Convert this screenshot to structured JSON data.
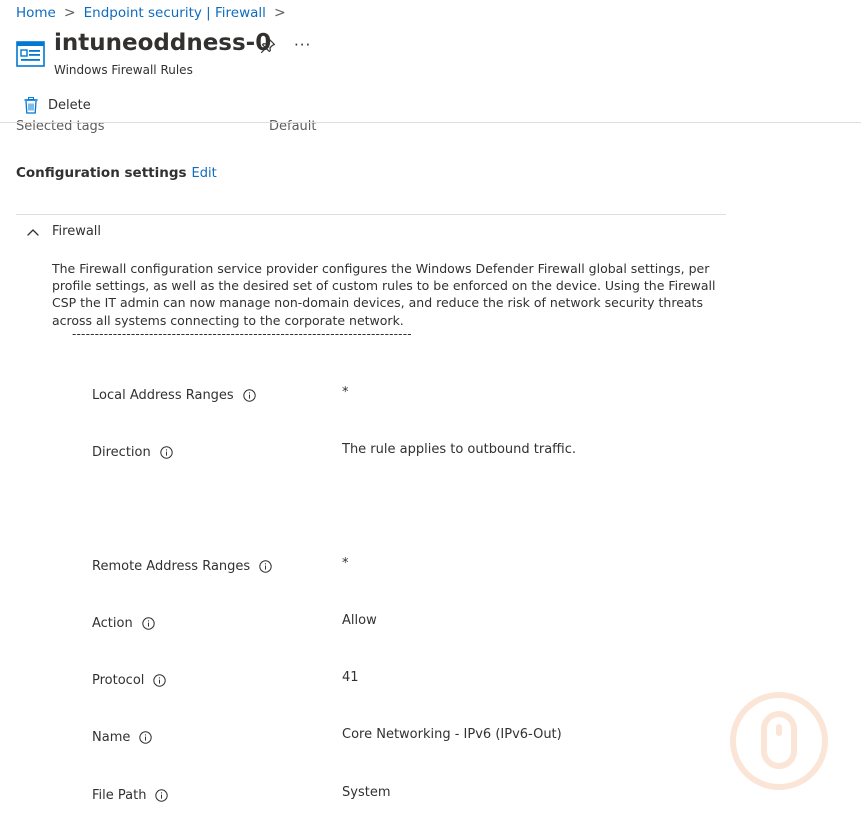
{
  "breadcrumb": {
    "home": "Home",
    "separator": ">",
    "parent": "Endpoint security | Firewall"
  },
  "header": {
    "title": "intuneoddness-0",
    "subtitle": "Windows Firewall Rules",
    "more": "···"
  },
  "toolbar": {
    "delete_label": "Delete"
  },
  "tags": {
    "label": "Selected tags",
    "value": "Default"
  },
  "config": {
    "title": "Configuration settings",
    "edit": "Edit"
  },
  "section": {
    "title": "Firewall",
    "description": "The Firewall configuration service provider configures the Windows Defender Firewall global settings, per profile settings, as well as the desired set of custom rules to be enforced on the device. Using the Firewall CSP the IT admin can now manage non-domain devices, and reduce the risk of network security threats across all systems connecting to the corporate network.",
    "dashes": "---------------------------------------------------------------------------"
  },
  "settings": [
    {
      "label": "Local Address Ranges",
      "value": "*"
    },
    {
      "label": "Direction",
      "value": "The rule applies to outbound traffic."
    },
    {
      "label": "Remote Address Ranges",
      "value": "*"
    },
    {
      "label": "Action",
      "value": "Allow"
    },
    {
      "label": "Protocol",
      "value": "41"
    },
    {
      "label": "Name",
      "value": "Core Networking - IPv6 (IPv6-Out)"
    },
    {
      "label": "File Path",
      "value": "System"
    }
  ],
  "colors": {
    "link": "#0f6cbd",
    "text": "#323130",
    "divider": "#e1dfdd",
    "icon_blue": "#0078d4",
    "watermark": "#fbe5d6"
  }
}
